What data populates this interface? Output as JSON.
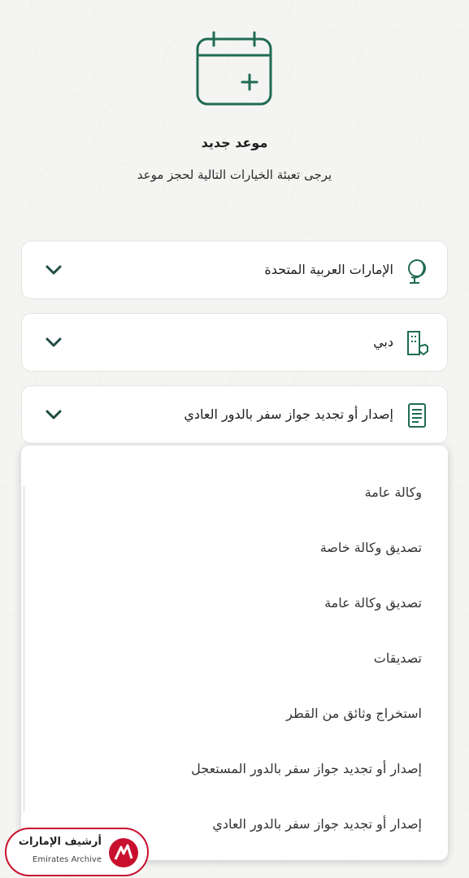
{
  "header": {
    "icon": "calendar-plus-icon",
    "title": "موعد جديد",
    "subtitle": "يرجى تعبئة الخيارات التالية لحجز موعد"
  },
  "fields": {
    "country": {
      "value": "الإمارات العربية المتحدة",
      "icon": "globe-icon"
    },
    "city": {
      "value": "دبي",
      "icon": "building-icon"
    },
    "service": {
      "value": "إصدار أو تجديد جواز سفر بالدور العادي",
      "icon": "document-icon"
    }
  },
  "dropdown": {
    "options": [
      "وكالة عامة",
      "تصديق وكالة خاصة",
      "تصديق وكالة عامة",
      "تصديقات",
      "استخراج وثائق من القطر",
      "إصدار أو تجديد جواز سفر بالدور المستعجل",
      "إصدار أو تجديد جواز سفر بالدور العادي"
    ]
  },
  "watermark": {
    "arabic": "أرشيف الإمارات",
    "english": "Emirates Archive"
  },
  "colors": {
    "accent": "#1f6b55",
    "watermark": "#c8102e"
  }
}
